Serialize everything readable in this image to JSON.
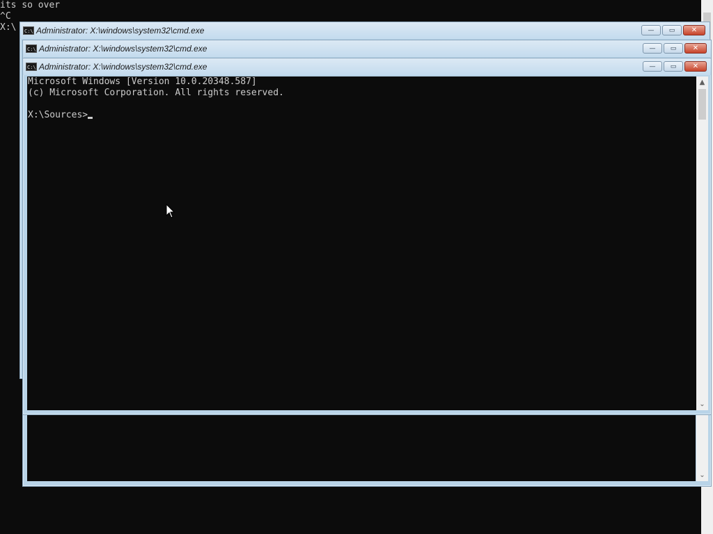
{
  "background_console": {
    "lines": [
      "its so over",
      "^C",
      "X:\\"
    ]
  },
  "windows": [
    {
      "title": "Administrator: X:\\windows\\system32\\cmd.exe",
      "icon": "cmd-icon",
      "icon_text": "C:\\"
    },
    {
      "title": "Administrator: X:\\windows\\system32\\cmd.exe",
      "icon": "cmd-icon",
      "icon_text": "C:\\"
    },
    {
      "title": "Administrator: X:\\windows\\system32\\cmd.exe",
      "icon": "cmd-icon",
      "icon_text": "C:\\",
      "console_lines": [
        "Microsoft Windows [Version 10.0.20348.587]",
        "(c) Microsoft Corporation. All rights reserved.",
        ""
      ],
      "prompt": "X:\\Sources>"
    }
  ],
  "caption_buttons": {
    "minimize": "—",
    "maximize": "▭",
    "close": "✕"
  },
  "scroll_arrows": {
    "up": "▲",
    "down": "⌄"
  },
  "colors": {
    "console_bg": "#0c0c0c",
    "console_text": "#cccccc",
    "titlebar": "#c4dbee",
    "close_button": "#c7432a"
  }
}
